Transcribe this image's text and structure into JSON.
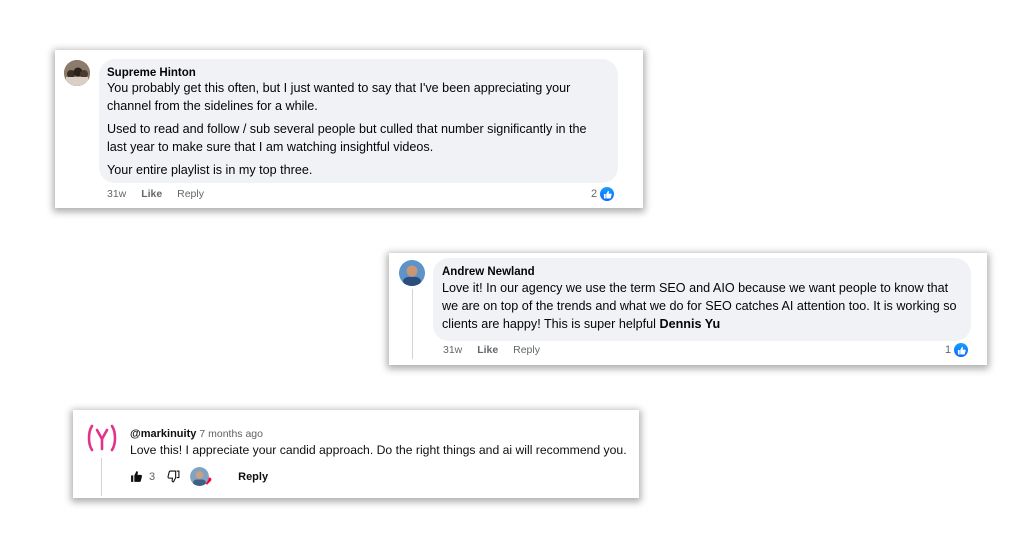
{
  "comment1": {
    "author": "Supreme Hinton",
    "paragraphs": [
      "You probably get this often, but I just wanted to say that I've been appreciating your channel from the sidelines for a while.",
      "Used to read and follow / sub several people but culled that number significantly in the last year to make sure that I am watching insightful videos.",
      "Your entire playlist is in my top three."
    ],
    "time": "31w",
    "like_label": "Like",
    "reply_label": "Reply",
    "like_count": "2"
  },
  "comment2": {
    "author": "Andrew Newland",
    "text": "Love it! In our agency we use the term SEO and AIO because we want people to know that we are on top of the trends and what we do for SEO catches AI attention too. It is working so clients are happy! This is super helpful ",
    "mention": "Dennis Yu",
    "time": "31w",
    "like_label": "Like",
    "reply_label": "Reply",
    "like_count": "1"
  },
  "comment3": {
    "author": "@markinuity",
    "time": "7 months ago",
    "text": "Love this! I appreciate your candid approach. Do the right things and ai will recommend you.",
    "like_count": "3",
    "reply_label": "Reply"
  },
  "colors": {
    "bubble": "#f0f2f5",
    "fb_blue": "#0866ff",
    "yt_logo_pink": "#e0348c"
  },
  "icons": [
    "thumbs-up-icon",
    "thumbs-down-icon",
    "like-reaction-icon",
    "heart-icon"
  ]
}
